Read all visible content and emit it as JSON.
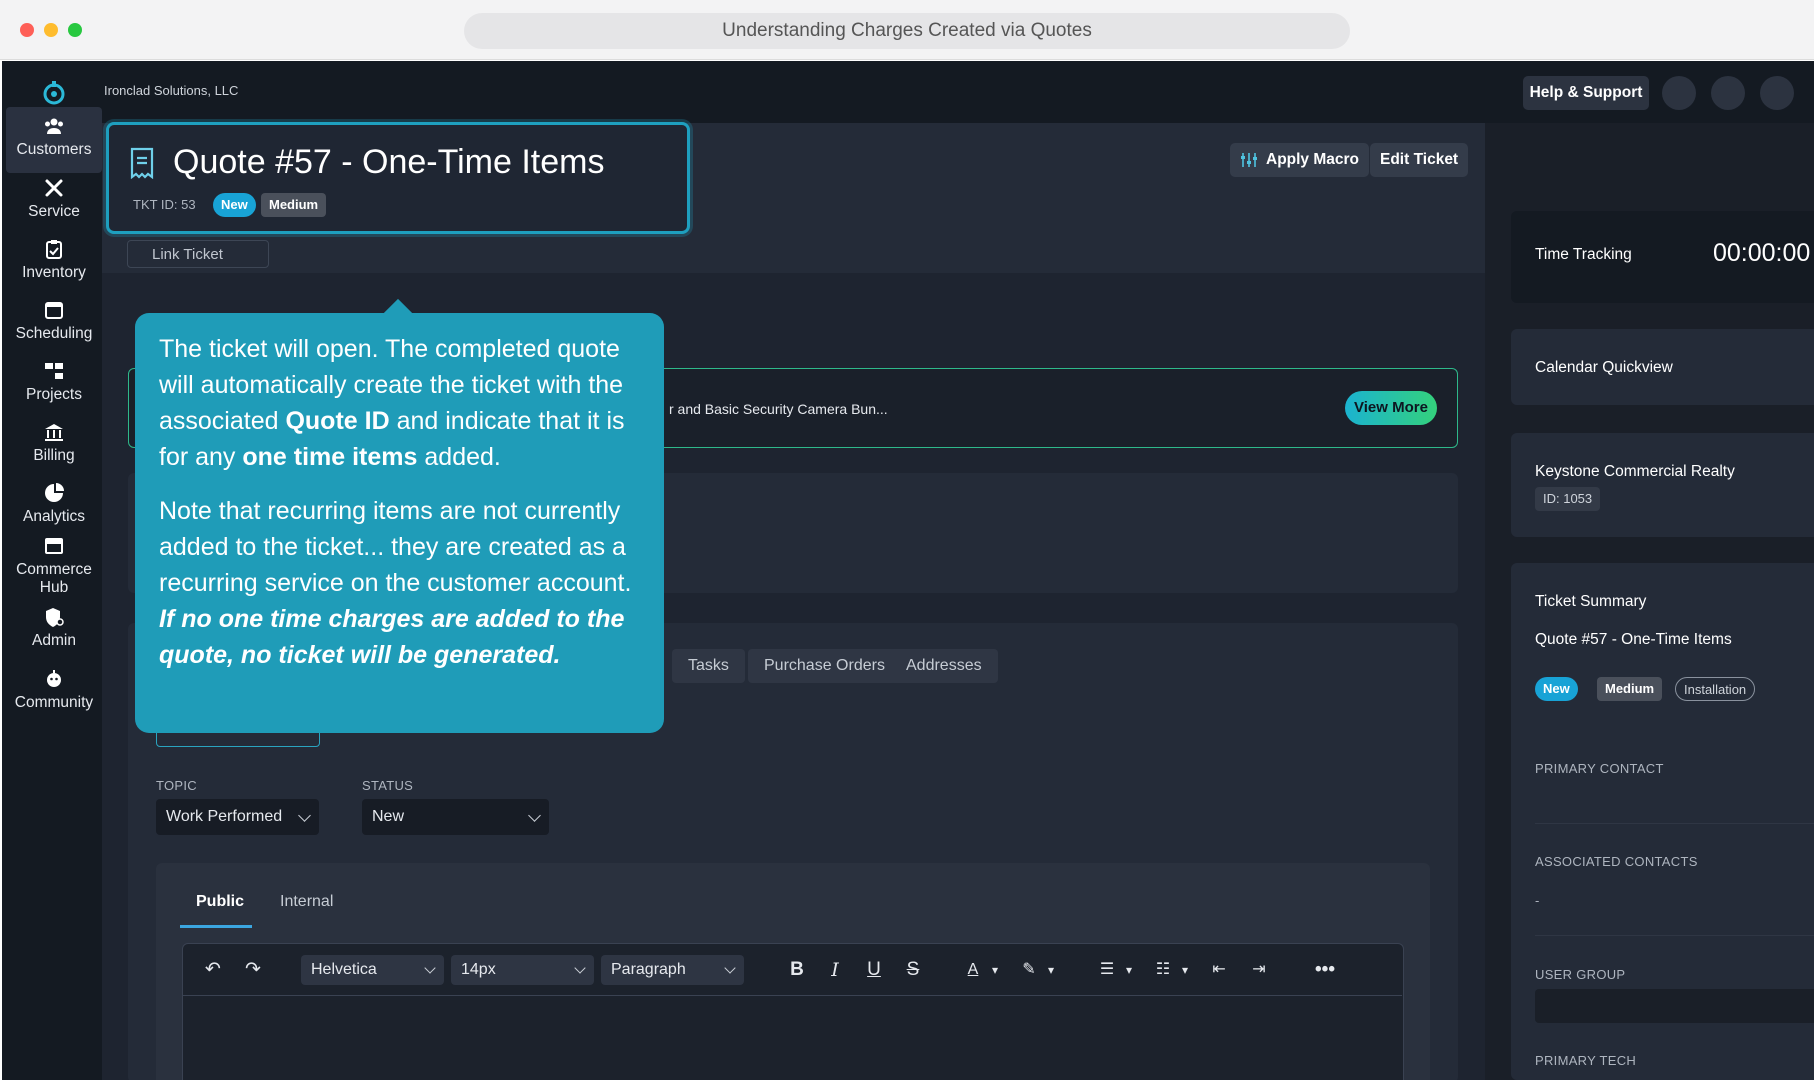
{
  "browser": {
    "tab_title": "Understanding Charges Created via Quotes"
  },
  "topbar": {
    "company": "Ironclad Solutions, LLC",
    "help_label": "Help & Support"
  },
  "sidebar": {
    "items": [
      {
        "label": "Customers",
        "icon": "customers-icon"
      },
      {
        "label": "Service",
        "icon": "tools-icon"
      },
      {
        "label": "Inventory",
        "icon": "clipboard-icon"
      },
      {
        "label": "Scheduling",
        "icon": "calendar-icon"
      },
      {
        "label": "Projects",
        "icon": "projects-icon"
      },
      {
        "label": "Billing",
        "icon": "bank-icon"
      },
      {
        "label": "Analytics",
        "icon": "pie-chart-icon"
      },
      {
        "label": "Commerce Hub",
        "icon": "store-icon"
      },
      {
        "label": "Admin",
        "icon": "admin-shield-icon"
      },
      {
        "label": "Community",
        "icon": "community-icon"
      }
    ]
  },
  "ticket": {
    "title": "Quote #57 - One-Time Items",
    "tkt_id": "TKT ID: 53",
    "status_badge": "New",
    "priority_badge": "Medium",
    "apply_macro": "Apply Macro",
    "edit_ticket": "Edit Ticket",
    "link_ticket": "Link Ticket"
  },
  "banner": {
    "text": "r and Basic Security Camera Bun...",
    "view_more": "View More"
  },
  "tabs": [
    "Tasks",
    "Purchase Orders",
    "Addresses"
  ],
  "form": {
    "topic_label": "TOPIC",
    "topic_value": "Work Performed",
    "status_label": "STATUS",
    "status_value": "New"
  },
  "editor": {
    "tab_public": "Public",
    "tab_internal": "Internal",
    "font": "Helvetica",
    "size": "14px",
    "block": "Paragraph"
  },
  "callout": {
    "p1_a": "The ticket will open. The completed quote will automatically create the ticket with the associated ",
    "p1_b": "Quote ID",
    "p1_c": " and indicate that it is for any ",
    "p1_d": "one time items",
    "p1_e": " added.",
    "p2_a": "Note that recurring items are not currently added to the ticket... they are created as a recurring service on the customer account. ",
    "p2_b": "If no one time charges are added to the quote, no ticket will be generated."
  },
  "right": {
    "time_tracking": "Time Tracking",
    "timer": "00:00:00",
    "calendar": "Calendar Quickview",
    "customer_name": "Keystone Commercial Realty",
    "customer_id": "ID: 1053",
    "summary_title": "Ticket Summary",
    "summary_ticket": "Quote #57 - One-Time Items",
    "badge_new": "New",
    "badge_medium": "Medium",
    "badge_type": "Installation",
    "primary_contact": "PRIMARY CONTACT",
    "associated_contacts": "ASSOCIATED CONTACTS",
    "associated_value": "-",
    "user_group": "USER GROUP",
    "primary_tech": "PRIMARY TECH"
  }
}
